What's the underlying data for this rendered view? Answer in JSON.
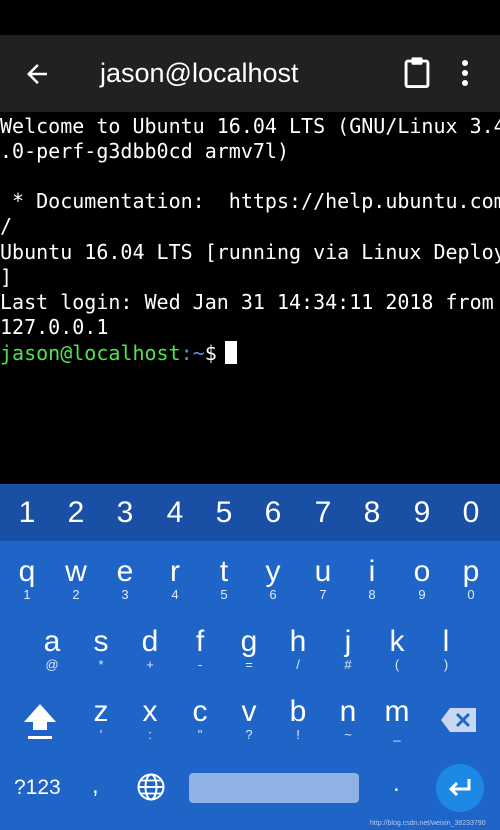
{
  "app_bar": {
    "title": "jason@localhost",
    "back_icon": "arrow-back-icon",
    "clipboard_icon": "clipboard-icon",
    "menu_icon": "more-vert-icon"
  },
  "terminal": {
    "lines": [
      "Welcome to Ubuntu 16.04 LTS (GNU/Linux 3.4",
      ".0-perf-g3dbb0cd armv7l)",
      "",
      " * Documentation:  https://help.ubuntu.com",
      "/",
      "Ubuntu 16.04 LTS [running via Linux Deploy",
      "]",
      "Last login: Wed Jan 31 14:34:11 2018 from",
      "127.0.0.1"
    ],
    "prompt_user": "jason@localhost",
    "prompt_path": ":~",
    "prompt_symbol": "$",
    "colors": {
      "user": "#4ee44e",
      "path": "#5b8bf2"
    }
  },
  "keyboard": {
    "numbers": [
      "1",
      "2",
      "3",
      "4",
      "5",
      "6",
      "7",
      "8",
      "9",
      "0"
    ],
    "row1": [
      {
        "main": "q",
        "sub": "1"
      },
      {
        "main": "w",
        "sub": "2"
      },
      {
        "main": "e",
        "sub": "3"
      },
      {
        "main": "r",
        "sub": "4"
      },
      {
        "main": "t",
        "sub": "5"
      },
      {
        "main": "y",
        "sub": "6"
      },
      {
        "main": "u",
        "sub": "7"
      },
      {
        "main": "i",
        "sub": "8"
      },
      {
        "main": "o",
        "sub": "9"
      },
      {
        "main": "p",
        "sub": "0"
      }
    ],
    "row2": [
      {
        "main": "a",
        "sub": "@"
      },
      {
        "main": "s",
        "sub": "*"
      },
      {
        "main": "d",
        "sub": "+"
      },
      {
        "main": "f",
        "sub": "-"
      },
      {
        "main": "g",
        "sub": "="
      },
      {
        "main": "h",
        "sub": "/"
      },
      {
        "main": "j",
        "sub": "#"
      },
      {
        "main": "k",
        "sub": "("
      },
      {
        "main": "l",
        "sub": ")"
      }
    ],
    "row3": [
      {
        "main": "z",
        "sub": "'"
      },
      {
        "main": "x",
        "sub": ":"
      },
      {
        "main": "c",
        "sub": "\""
      },
      {
        "main": "v",
        "sub": "?"
      },
      {
        "main": "b",
        "sub": "!"
      },
      {
        "main": "n",
        "sub": "~"
      },
      {
        "main": "m",
        "sub": "_"
      }
    ],
    "symbols_label": "?123",
    "comma": ",",
    "period": ".",
    "shift_icon": "shift-arrow-icon",
    "backspace_icon": "backspace-icon",
    "globe_icon": "globe-icon",
    "enter_icon": "enter-return-icon",
    "colors": {
      "background": "#1f64c7",
      "number_row": "#1a4fa6",
      "enter": "#1e88e5"
    }
  },
  "watermark": "http://blog.csdn.net/weixin_38233790"
}
